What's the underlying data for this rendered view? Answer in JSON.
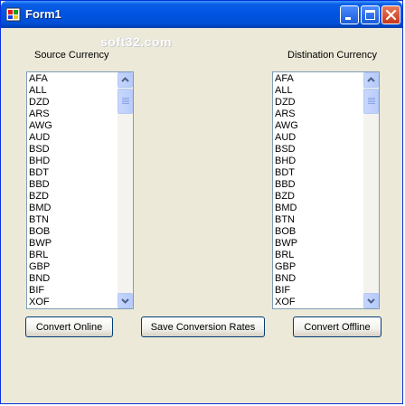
{
  "window": {
    "title": "Form1"
  },
  "watermark": "soft32.com",
  "source": {
    "label": "Source Currency",
    "items": [
      "AFA",
      "ALL",
      "DZD",
      "ARS",
      "AWG",
      "AUD",
      "BSD",
      "BHD",
      "BDT",
      "BBD",
      "BZD",
      "BMD",
      "BTN",
      "BOB",
      "BWP",
      "BRL",
      "GBP",
      "BND",
      "BIF",
      "XOF"
    ]
  },
  "destination": {
    "label": "Distination Currency",
    "items": [
      "AFA",
      "ALL",
      "DZD",
      "ARS",
      "AWG",
      "AUD",
      "BSD",
      "BHD",
      "BDT",
      "BBD",
      "BZD",
      "BMD",
      "BTN",
      "BOB",
      "BWP",
      "BRL",
      "GBP",
      "BND",
      "BIF",
      "XOF"
    ]
  },
  "buttons": {
    "convert_online": "Convert Online",
    "save_rates": "Save Conversion Rates",
    "convert_offline": "Convert Offline"
  },
  "icons": {
    "app": "app-icon",
    "minimize": "minimize-icon",
    "maximize": "maximize-icon",
    "close": "close-icon",
    "scroll_up": "chevron-up-icon",
    "scroll_down": "chevron-down-icon"
  }
}
